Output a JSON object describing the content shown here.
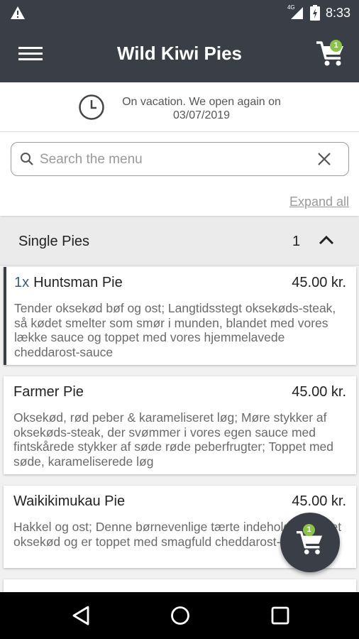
{
  "status_bar": {
    "time": "8:33",
    "network": "4G",
    "icons": [
      "warning-icon",
      "signal-icon",
      "battery-icon"
    ]
  },
  "app_bar": {
    "title": "Wild Kiwi Pies",
    "cart_count": "1",
    "icons": [
      "menu-icon",
      "cart-icon"
    ]
  },
  "notice": {
    "text": "On vacation. We open again on 03/07/2019",
    "icon": "clock-icon"
  },
  "search": {
    "placeholder": "Search the menu",
    "value": "",
    "expand_all_label": "Expand all"
  },
  "category": {
    "title": "Single Pies",
    "count": "1",
    "expanded": true
  },
  "items": [
    {
      "qty_label": "1x",
      "name": "Huntsman Pie",
      "price": "45.00 kr.",
      "description": "Tender oksekød bøf og ost; Langtidsstegt oksekøds-steak, så kødet smelter som smør i munden, blandet med vores lække sauce og toppet med vores hjemmelavede cheddarost-sauce"
    },
    {
      "qty_label": "",
      "name": "Farmer Pie",
      "price": "45.00 kr.",
      "description": "Oksekød, rød peber & karameliseret løg; Møre stykker af oksekøds-steak, der svømmer i vores egen sauce med fintskårede stykker af søde røde peberfrugter; Toppet med søde, karameliserede løg"
    },
    {
      "qty_label": "",
      "name": "Waikikimukau Pie",
      "price": "45.00 kr.",
      "description": "Hakkel og ost; Denne børnevenlige tærte indeholder hakket oksekød og er toppet med smagfuld cheddarost-sauce"
    }
  ],
  "fab": {
    "cart_count": "1"
  },
  "nav_bar": {
    "icons": [
      "back-icon",
      "home-icon",
      "recents-icon"
    ]
  },
  "colors": {
    "app_bar": "#3a3f47",
    "badge": "#8bc34a",
    "qty_accent": "#3f5a80"
  }
}
